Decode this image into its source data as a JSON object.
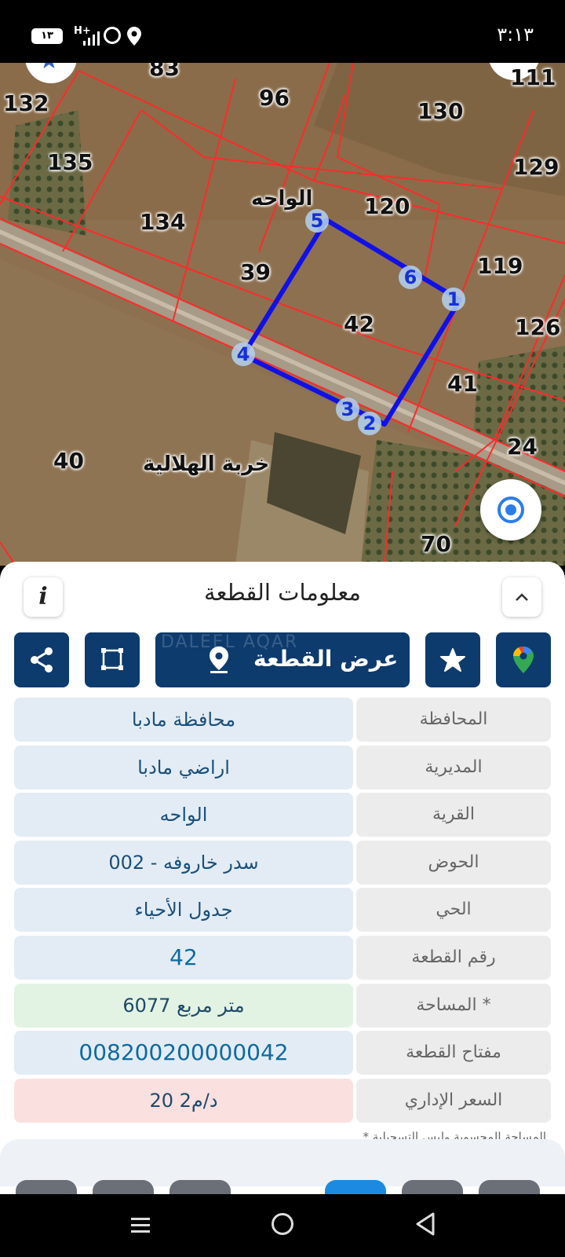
{
  "status_bar": {
    "battery": "١٣",
    "network": "H+",
    "time": "٣:١٣"
  },
  "map": {
    "parcel_labels": [
      "83",
      "96",
      "111",
      "132",
      "130",
      "135",
      "129",
      "134",
      "120",
      "39",
      "119",
      "42",
      "126",
      "41",
      "24",
      "40",
      "70"
    ],
    "selected_parcel": "42",
    "vertex_labels": [
      "1",
      "2",
      "3",
      "4",
      "5",
      "6"
    ],
    "place_labels": [
      "الواحه",
      "خربة الهلالية"
    ],
    "colors": {
      "parcel_lines": "#ff2a2a",
      "selected_outline": "#1010e8",
      "vertex_text": "#1530d8"
    }
  },
  "panel": {
    "title": "معلومات القطعة",
    "info_icon": "i",
    "actions": {
      "view_parcel": "عرض القطعة"
    },
    "watermark": "DALEEL AQAR",
    "rows": [
      {
        "label": "المحافظة",
        "value": "محافظة مادبا",
        "style": "blue"
      },
      {
        "label": "المديرية",
        "value": "اراضي مادبا",
        "style": "blue"
      },
      {
        "label": "القرية",
        "value": "الواحه",
        "style": "blue"
      },
      {
        "label": "الحوض",
        "value": "سدر خاروفه - 002",
        "style": "blue"
      },
      {
        "label": "الحي",
        "value": "جدول الأحياء",
        "style": "blue"
      },
      {
        "label": "رقم القطعة",
        "value": "42",
        "style": "big"
      },
      {
        "label": "المساحة *",
        "value": "6077 متر مربع",
        "style": "green"
      },
      {
        "label": "مفتاح القطعة",
        "value": "008200200000042",
        "style": "big"
      },
      {
        "label": "السعر الإداري",
        "value": "20 د/م2",
        "style": "pink"
      }
    ],
    "footnote": "* المساحة المحسوبة وليس التسجيلية"
  },
  "icons": {
    "share": "share-icon",
    "polygon": "polygon-icon",
    "pin": "map-pin-icon",
    "star": "star-icon",
    "google_maps": "google-maps-icon",
    "locate": "locate-icon",
    "chevron": "chevron-up-icon"
  }
}
